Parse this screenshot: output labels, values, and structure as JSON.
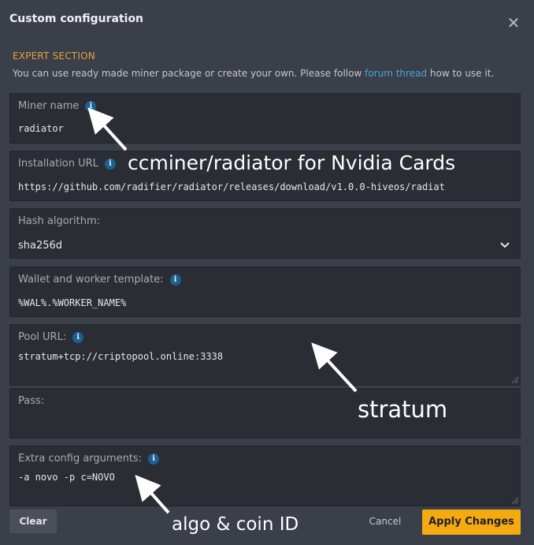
{
  "dialog": {
    "title": "Custom configuration",
    "close_label": "✕"
  },
  "section": {
    "label": "EXPERT SECTION",
    "desc_before": "You can use ready made miner package or create your own. Please follow ",
    "link_text": "forum thread",
    "desc_after": " how to use it."
  },
  "fields": {
    "miner_name": {
      "label": "Miner name",
      "value": "radiator"
    },
    "installation_url": {
      "label": "Installation URL",
      "value": "https://github.com/radifier/radiator/releases/download/v1.0.0-hiveos/radiat"
    },
    "hash_algorithm": {
      "label": "Hash algorithm:",
      "value": "sha256d"
    },
    "wallet_template": {
      "label": "Wallet and worker template:",
      "value": "%WAL%.%WORKER_NAME%"
    },
    "pool_url": {
      "label": "Pool URL:",
      "value": "stratum+tcp://criptopool.online:3338"
    },
    "pass": {
      "label": "Pass:",
      "value": ""
    },
    "extra_args": {
      "label": "Extra config arguments:",
      "value": "-a novo -p c=NOVO"
    }
  },
  "info_icon_glyph": "i",
  "annotations": {
    "miner": "ccminer/radiator for Nvidia Cards",
    "stratum": "stratum",
    "algo": "algo & coin ID"
  },
  "buttons": {
    "clear": "Clear",
    "cancel": "Cancel",
    "apply": "Apply Changes"
  },
  "colors": {
    "background": "#3b3f49",
    "field_bg": "#2a2d34",
    "accent_orange": "#e3a43a",
    "apply_button": "#f5ab10",
    "link": "#4aa3df"
  }
}
